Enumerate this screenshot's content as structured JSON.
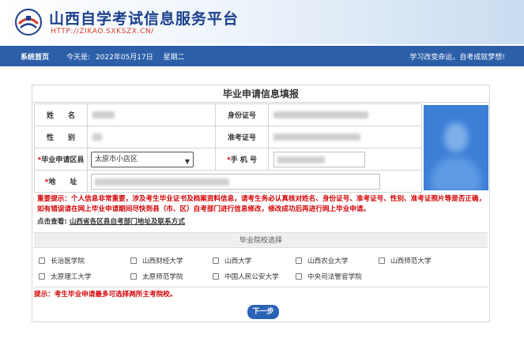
{
  "header": {
    "title": "山西自学考试信息服务平台",
    "url": "HTTP://ZIKAO.SXKSZX.CN/",
    "logo_icon": "emblem-logo-icon"
  },
  "nav": {
    "home": "系统首页",
    "date_label": "今天是:",
    "date": "2022年05月17日",
    "weekday": "星期二",
    "slogan": "学习改变命运，自考成就梦想!"
  },
  "form": {
    "title": "毕业申请信息填报",
    "name_label": "姓　　名",
    "id_label": "身份证号",
    "gender_label": "性　　别",
    "exam_no_label": "准考证号",
    "area_label": "毕业申请区县",
    "area_value": "太原市小店区",
    "phone_label": "手 机 号",
    "address_label": "地　　址",
    "required_mark": "*"
  },
  "notice": {
    "text": "重要提示：个人信息非常重要，涉及考生毕业证书及档案资料信息，请考生务必认真核对姓名、身份证号、准考证号、性别、准考证照片等是否正确，如有错误请在网上毕业申请期间尽快到县（市、区）自考部门进行信息修改，修改成功后再进行网上毕业申请。"
  },
  "check": {
    "label": "点击查看:",
    "link": "山西省各区县自考部门地址及联系方式"
  },
  "schools": {
    "title": "毕业院校选择",
    "items": [
      "长治医学院",
      "山西财经大学",
      "山西大学",
      "山西农业大学",
      "山西师范大学",
      "太原理工大学",
      "太原师范学院",
      "中国人民公安大学",
      "中央司法警官学院"
    ]
  },
  "tip": "提示：考生毕业申请最多可选择两所主考院校。",
  "next_button": "下一步",
  "colors": {
    "nav_blue": "#2c5fa8",
    "title_blue": "#1b3f8c",
    "alert_red": "#d40000",
    "button_blue": "#2a62b6"
  }
}
